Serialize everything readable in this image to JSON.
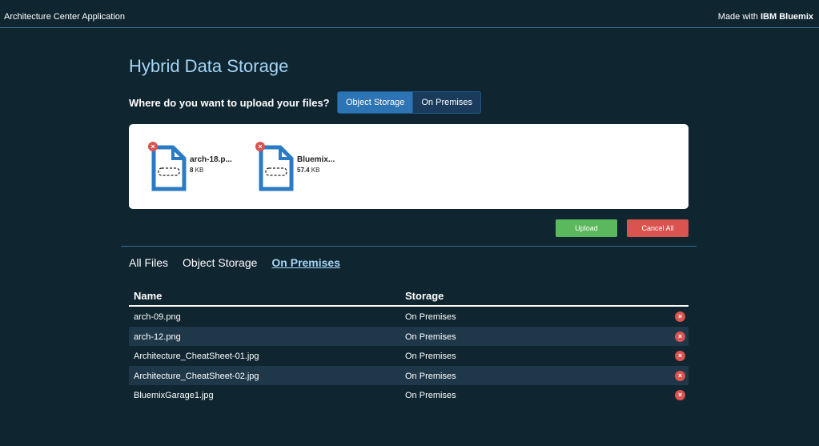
{
  "header": {
    "app_title": "Architecture Center Application",
    "made_with_prefix": "Made with ",
    "made_with_brand": "IBM Bluemix"
  },
  "main": {
    "title": "Hybrid Data Storage",
    "question": "Where do you want to upload your files?",
    "destination_options": [
      "Object Storage",
      "On Premises"
    ],
    "selected_destination": "Object Storage"
  },
  "pending_files": [
    {
      "name": "arch-18.p...",
      "size_value": "8",
      "size_unit": " KB"
    },
    {
      "name": "Bluemix...",
      "size_value": "57.4",
      "size_unit": " KB"
    }
  ],
  "actions": {
    "upload_label": "Upload",
    "cancel_label": "Cancel All"
  },
  "filter_tabs": {
    "items": [
      "All Files",
      "Object Storage",
      "On Premises"
    ],
    "active": "On Premises"
  },
  "table": {
    "headers": {
      "name": "Name",
      "storage": "Storage"
    },
    "rows": [
      {
        "name": "arch-09.png",
        "storage": "On Premises"
      },
      {
        "name": "arch-12.png",
        "storage": "On Premises"
      },
      {
        "name": "Architecture_CheatSheet-01.jpg",
        "storage": "On Premises"
      },
      {
        "name": "Architecture_CheatSheet-02.jpg",
        "storage": "On Premises"
      },
      {
        "name": "BluemixGarage1.jpg",
        "storage": "On Premises"
      }
    ]
  },
  "icons": {
    "file": "file-icon",
    "remove": "remove-icon"
  },
  "colors": {
    "background": "#0f2530",
    "accent_blue": "#2c74b3",
    "title_blue": "#a6d5f5",
    "upload_green": "#5cb85c",
    "cancel_red": "#d9534f",
    "file_icon_blue": "#2b7bc4"
  }
}
